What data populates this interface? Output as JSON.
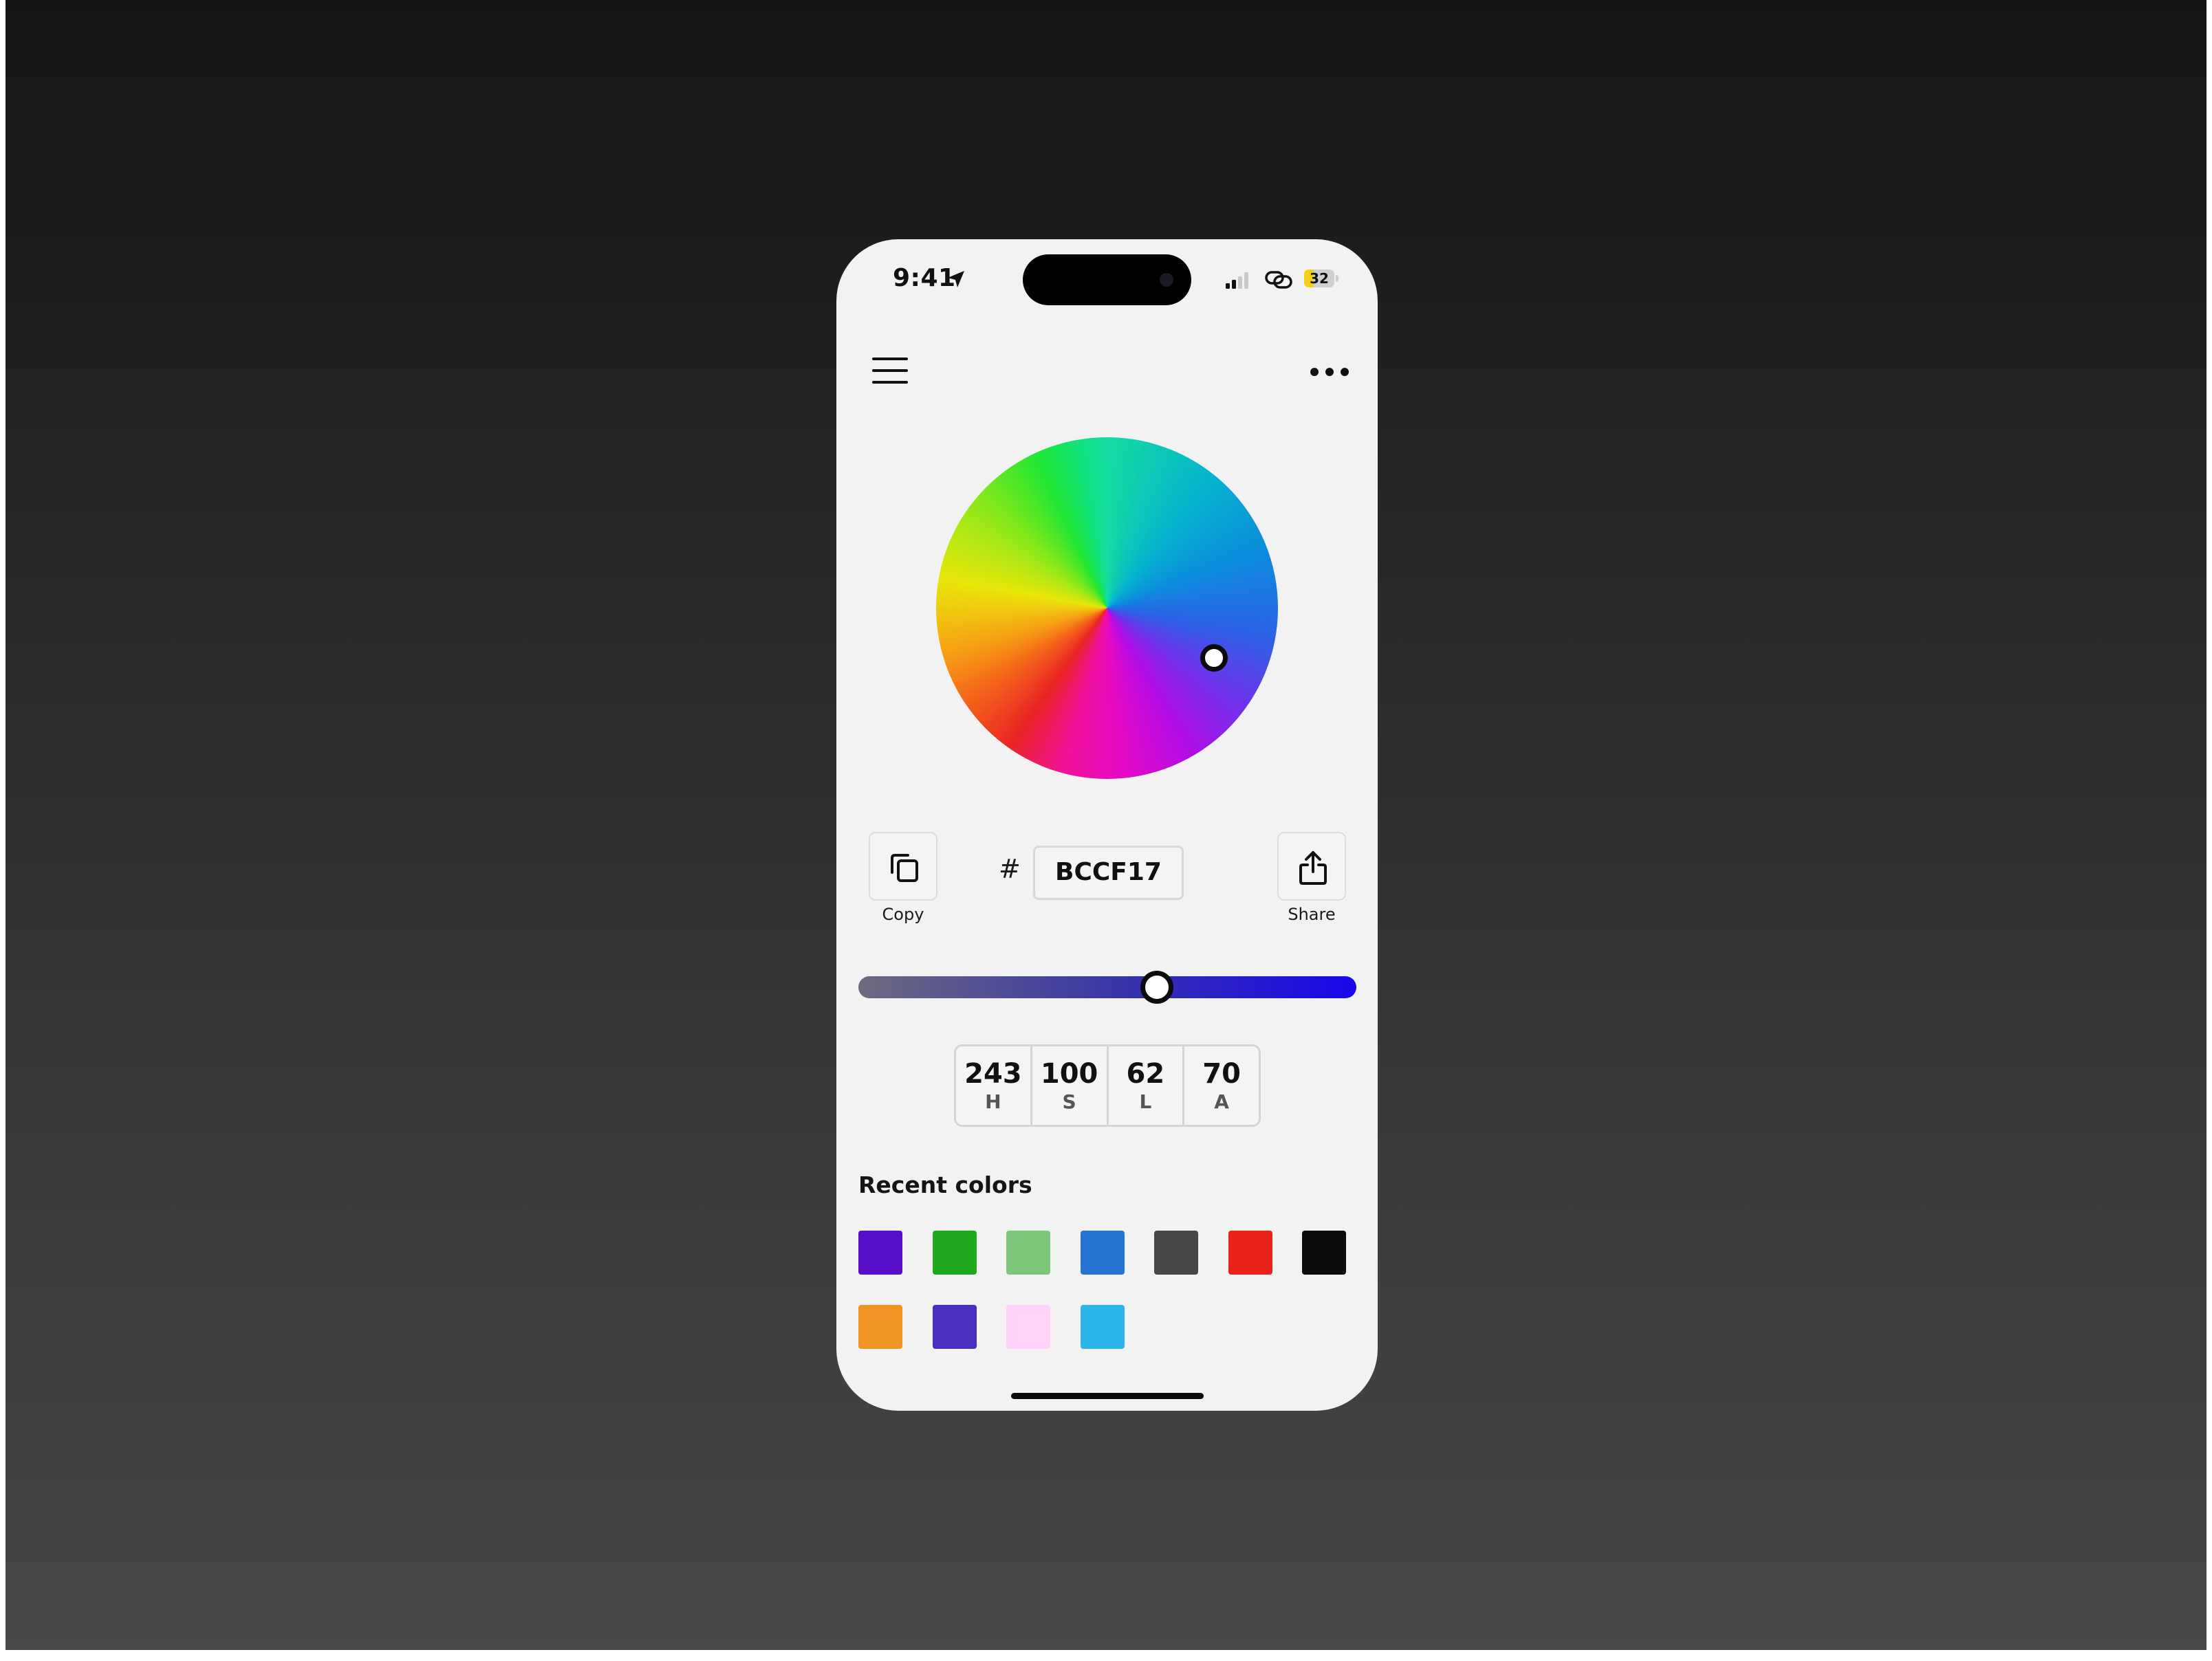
{
  "status_bar": {
    "time": "9:41",
    "battery_level": "32",
    "battery_color": "#f2cf1a"
  },
  "icons": {
    "menu": "hamburger-menu-icon",
    "more": "more-horizontal-icon",
    "copy": "copy-icon",
    "share": "share-icon",
    "location": "location-arrow-icon",
    "signal": "signal-icon",
    "link": "link-icon",
    "battery": "battery-icon"
  },
  "picker": {
    "hash_symbol": "#",
    "hex_value": "BCCF17",
    "copy_label": "Copy",
    "share_label": "Share",
    "lightness_slider_value": 0.6
  },
  "hsla": [
    {
      "value": "243",
      "label": "H"
    },
    {
      "value": "100",
      "label": "S"
    },
    {
      "value": "62",
      "label": "L"
    },
    {
      "value": "70",
      "label": "A"
    }
  ],
  "recent": {
    "title": "Recent colors",
    "swatches": [
      "#5710c7",
      "#22a81f",
      "#7fc67d",
      "#2574d1",
      "#464646",
      "#e7231b",
      "#0c0c0c",
      "#ee9525",
      "#4a2fbe",
      "#ffd3f7",
      "#2db6ec"
    ]
  }
}
